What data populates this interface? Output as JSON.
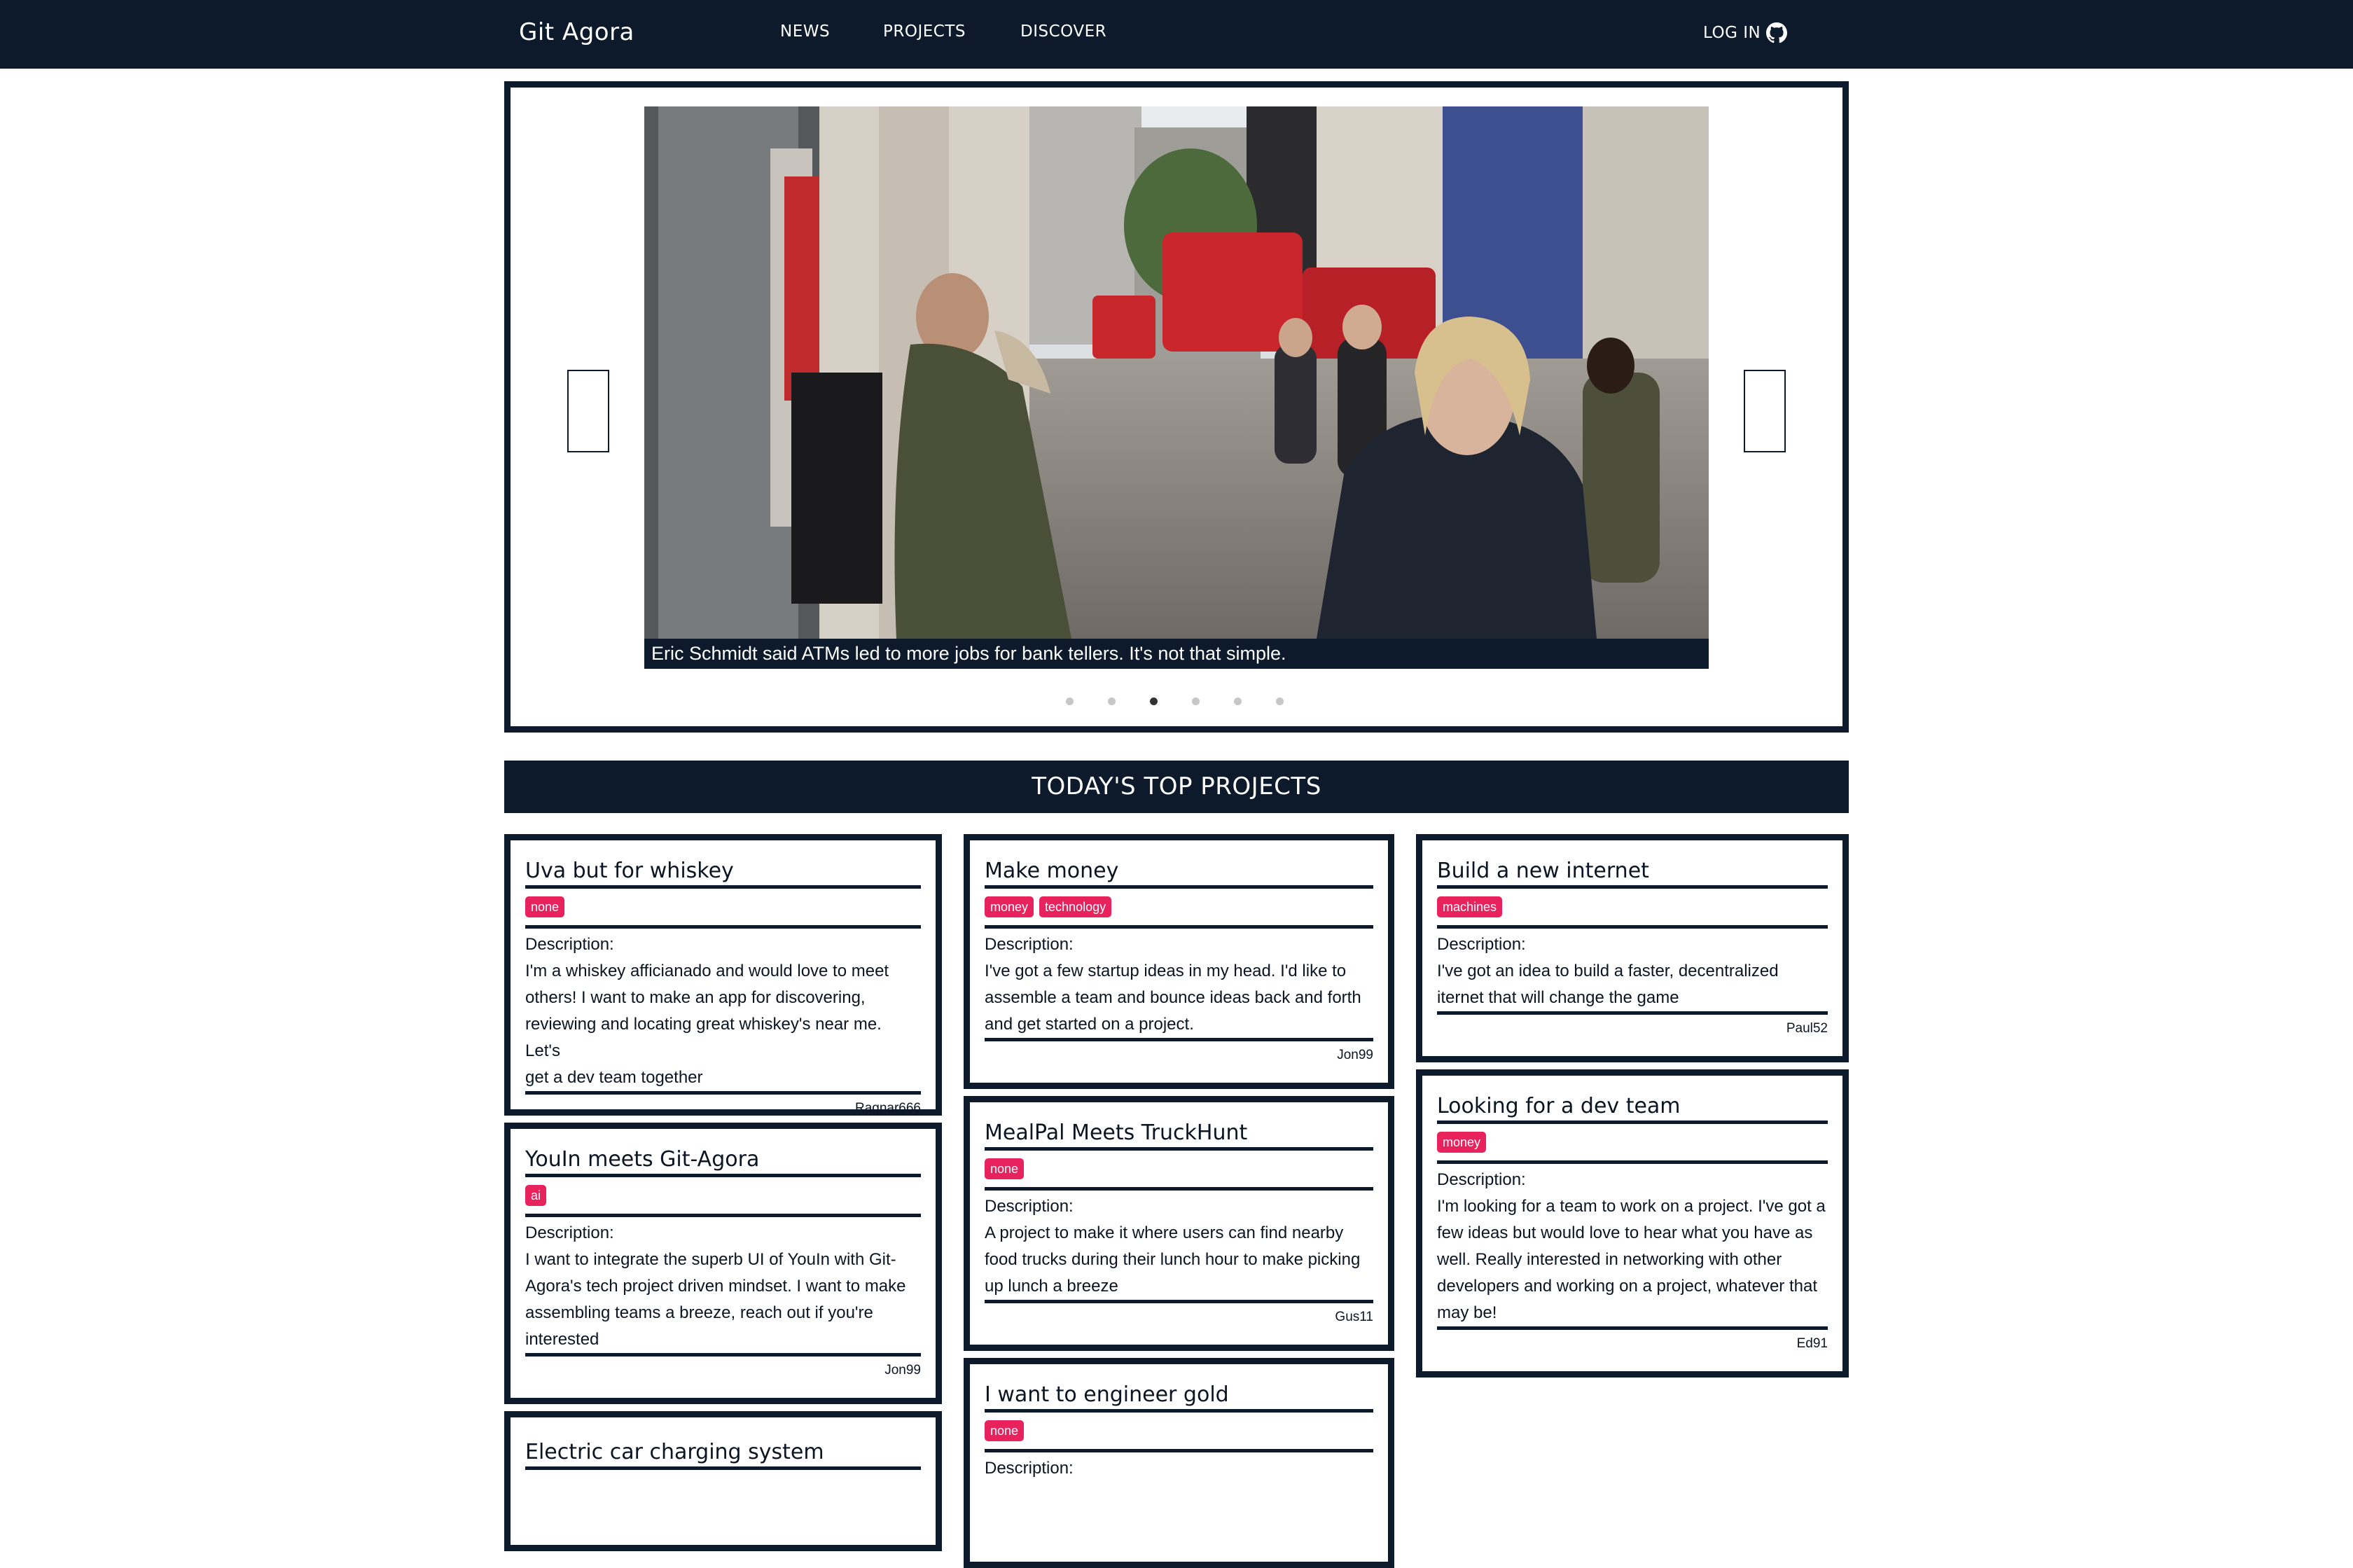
{
  "nav": {
    "brand": "Git Agora",
    "links": [
      "NEWS",
      "PROJECTS",
      "DISCOVER"
    ],
    "login": "LOG IN"
  },
  "carousel": {
    "caption": "Eric Schmidt said ATMs led to more jobs for bank tellers. It's not that simple.",
    "dot_count": 6,
    "active_dot": 3
  },
  "section": {
    "title": "TODAY'S TOP PROJECTS"
  },
  "projects": [
    {
      "title": "Uva but for whiskey",
      "tags": [
        "none"
      ],
      "description_label": "Description:",
      "description": [
        "I'm a whiskey afficianado and would love to meet",
        "others! I want to make an app for discovering,",
        "reviewing and locating great whiskey's near me. Let's",
        "get a dev team together"
      ],
      "author": "Ragnar666"
    },
    {
      "title": "YouIn meets Git-Agora",
      "tags": [
        "ai"
      ],
      "description_label": "Description:",
      "description": [
        "I want to integrate the superb UI of YouIn with Git-",
        "Agora's tech project driven mindset. I want to make",
        "assembling teams a breeze, reach out if you're",
        "interested"
      ],
      "author": "Jon99"
    },
    {
      "title": "Electric car charging system",
      "tags": [],
      "description_label": "",
      "description": [],
      "author": ""
    },
    {
      "title": "Make money",
      "tags": [
        "money",
        "technology"
      ],
      "description_label": "Description:",
      "description": [
        "I've got a few startup ideas in my head. I'd like to",
        "assemble a team and bounce ideas back and forth",
        "and get started on a project."
      ],
      "author": "Jon99"
    },
    {
      "title": "MealPal Meets TruckHunt",
      "tags": [
        "none"
      ],
      "description_label": "Description:",
      "description": [
        "A project to make it where users can find nearby",
        "food trucks during their lunch hour to make picking",
        "up lunch a breeze"
      ],
      "author": "Gus11"
    },
    {
      "title": "I want to engineer gold",
      "tags": [
        "none"
      ],
      "description_label": "Description:",
      "description": [],
      "author": ""
    },
    {
      "title": "Build a new internet",
      "tags": [
        "machines"
      ],
      "description_label": "Description:",
      "description": [
        "I've got an idea to build a faster, decentralized",
        "iternet that will change the game"
      ],
      "author": "Paul52"
    },
    {
      "title": "Looking for a dev team",
      "tags": [
        "money"
      ],
      "description_label": "Description:",
      "description": [
        "I'm looking for a team to work on a project. I've got a",
        "few ideas but would love to hear what you have as",
        "well. Really interested in networking with other",
        "developers and working on a project, whatever that",
        "may be!"
      ],
      "author": "Ed91"
    }
  ]
}
